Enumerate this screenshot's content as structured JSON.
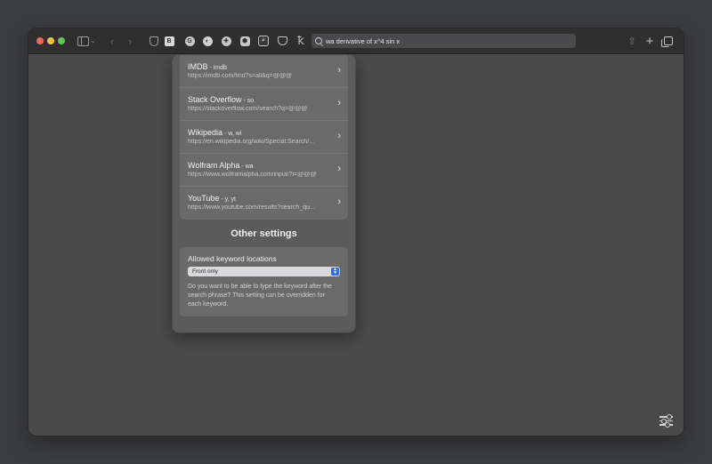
{
  "toolbar": {
    "address_query": "wa derivative of x^4 sin x",
    "extensions": [
      "privacy-shield-icon",
      "bitwarden-icon",
      "grammarly-icon",
      "dark-reader-icon",
      "puzzle-icon",
      "ublock-icon",
      "keyword-search-icon",
      "pocket-icon",
      "translate-icon"
    ],
    "extension_letters": {
      "bitwarden": "B",
      "grammarly": "G"
    }
  },
  "popover": {
    "keywords": [
      {
        "name": "IMDB",
        "alias": "imdb",
        "url": "https://imdb.com/find?s=all&q=@@@"
      },
      {
        "name": "Stack Overflow",
        "alias": "so",
        "url": "https://stackoverflow.com/search?q=@@@"
      },
      {
        "name": "Wikipedia",
        "alias": "w, wi",
        "url": "https://en.wikipedia.org/wiki/Special:Search/..."
      },
      {
        "name": "Wolfram Alpha",
        "alias": "wa",
        "url": "https://www.wolframalpha.com/input/?i=@@@"
      },
      {
        "name": "YouTube",
        "alias": "y, yt",
        "url": "https://www.youtube.com/results?search_qu..."
      }
    ],
    "separator": " - ",
    "other_settings_title": "Other settings",
    "allowed_locations": {
      "label": "Allowed keyword locations",
      "selected": "Front only",
      "help": "Do you want to be able to type the keyword after the search phrase? This setting can be overridden for each keyword."
    }
  },
  "colors": {
    "traffic_red": "#ec6a5e",
    "traffic_yellow": "#f4bf4f",
    "traffic_green": "#61c554",
    "select_accent": "#2f6fd6"
  }
}
